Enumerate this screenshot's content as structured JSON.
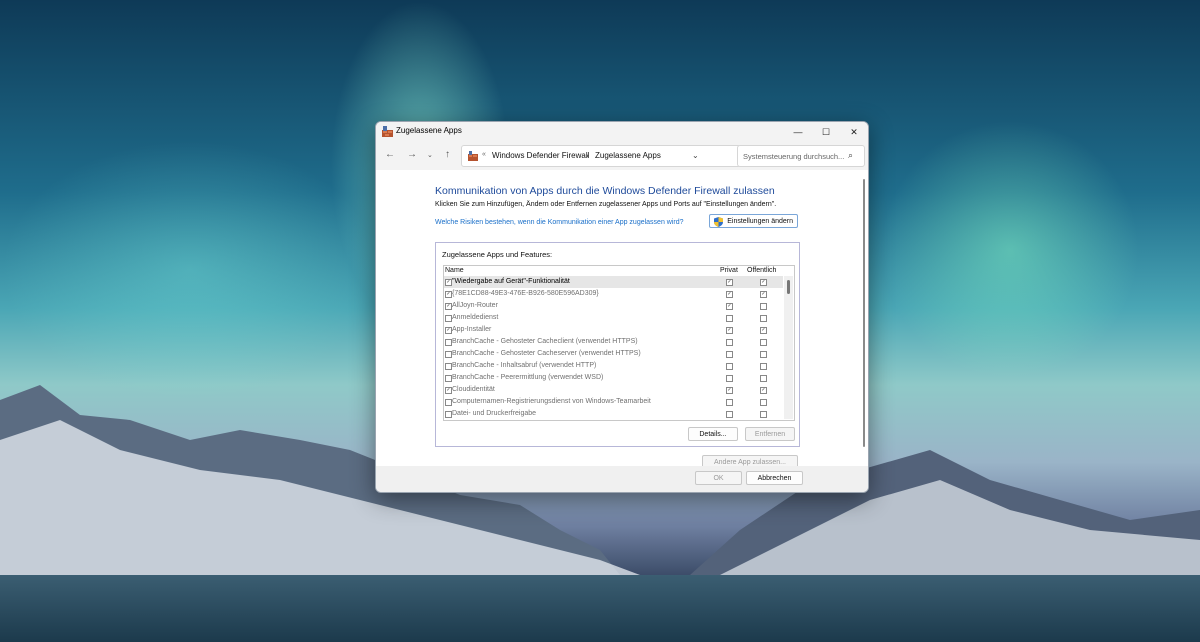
{
  "window": {
    "title": "Zugelassene Apps",
    "controls": {
      "minimize": "—",
      "maximize": "☐",
      "close": "✕"
    }
  },
  "nav": {
    "back": "←",
    "forward": "→",
    "dropdown": "⌄",
    "up": "↑",
    "address_prefix": "«",
    "breadcrumb": [
      "Windows Defender Firewall",
      "Zugelassene Apps"
    ],
    "breadcrumb_sep": "›",
    "address_dropdown": "⌄",
    "refresh": "↻",
    "search_placeholder": "Systemsteuerung durchsuch...",
    "search_icon": "⌕"
  },
  "main": {
    "heading": "Kommunikation von Apps durch die Windows Defender Firewall zulassen",
    "description": "Klicken Sie zum Hinzufügen, Ändern oder Entfernen zugelassener Apps und Ports auf \"Einstellungen ändern\".",
    "risk_link": "Welche Risiken bestehen, wenn die Kommunikation einer App zugelassen wird?",
    "change_settings": "Einstellungen ändern",
    "group_label": "Zugelassene Apps und Features:",
    "columns": {
      "name": "Name",
      "private": "Privat",
      "public": "Öffentlich"
    },
    "rows": [
      {
        "name": "\"Wiedergabe auf Gerät\"-Funktionalität",
        "enabled": "✓",
        "private": "✓",
        "public": "✓"
      },
      {
        "name": "{78E1CD88-49E3-476E-B926-580E596AD309}",
        "enabled": "✓",
        "private": "✓",
        "public": "✓"
      },
      {
        "name": "AllJoyn-Router",
        "enabled": "✓",
        "private": "✓",
        "public": ""
      },
      {
        "name": "Anmeldedienst",
        "enabled": "",
        "private": "",
        "public": ""
      },
      {
        "name": "App-Installer",
        "enabled": "✓",
        "private": "✓",
        "public": "✓"
      },
      {
        "name": "BranchCache - Gehosteter Cacheclient (verwendet HTTPS)",
        "enabled": "",
        "private": "",
        "public": ""
      },
      {
        "name": "BranchCache - Gehosteter Cacheserver (verwendet HTTPS)",
        "enabled": "",
        "private": "",
        "public": ""
      },
      {
        "name": "BranchCache - Inhaltsabruf (verwendet HTTP)",
        "enabled": "",
        "private": "",
        "public": ""
      },
      {
        "name": "BranchCache - Peerermittlung (verwendet WSD)",
        "enabled": "",
        "private": "",
        "public": ""
      },
      {
        "name": "Cloudidentität",
        "enabled": "✓",
        "private": "✓",
        "public": "✓"
      },
      {
        "name": "Computernamen-Registrierungsdienst von Windows-Teamarbeit",
        "enabled": "",
        "private": "",
        "public": ""
      },
      {
        "name": "Datei- und Druckerfreigabe",
        "enabled": "",
        "private": "",
        "public": ""
      }
    ],
    "details_button": "Details...",
    "remove_button": "Entfernen",
    "allow_other_button": "Andere App zulassen..."
  },
  "footer": {
    "ok": "OK",
    "cancel": "Abbrechen"
  },
  "colors": {
    "heading": "#1e4a9a",
    "link": "#1a6fc9",
    "disabled_text": "#9a9a9a"
  }
}
